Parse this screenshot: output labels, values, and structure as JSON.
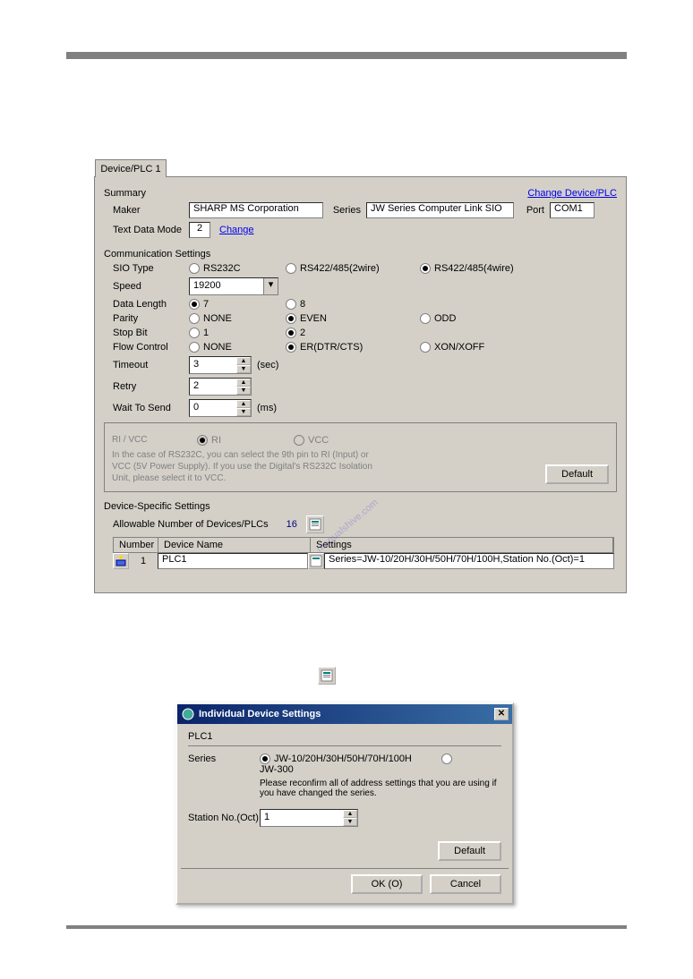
{
  "tab": "Device/PLC 1",
  "summary": {
    "title": "Summary",
    "change_link": "Change Device/PLC",
    "maker_label": "Maker",
    "maker_value": "SHARP MS Corporation",
    "series_label": "Series",
    "series_value": "JW Series Computer Link SIO",
    "port_label": "Port",
    "port_value": "COM1",
    "text_data_mode_label": "Text Data Mode",
    "text_data_mode_value": "2",
    "change_label": "Change"
  },
  "comm": {
    "title": "Communication Settings",
    "sio_type_label": "SIO Type",
    "sio_rs232c": "RS232C",
    "sio_rs422_2w": "RS422/485(2wire)",
    "sio_rs422_4w": "RS422/485(4wire)",
    "speed_label": "Speed",
    "speed_value": "19200",
    "data_length_label": "Data Length",
    "dl_7": "7",
    "dl_8": "8",
    "parity_label": "Parity",
    "parity_none": "NONE",
    "parity_even": "EVEN",
    "parity_odd": "ODD",
    "stop_bit_label": "Stop Bit",
    "sb_1": "1",
    "sb_2": "2",
    "flow_label": "Flow Control",
    "flow_none": "NONE",
    "flow_er": "ER(DTR/CTS)",
    "flow_xon": "XON/XOFF",
    "timeout_label": "Timeout",
    "timeout_value": "3",
    "timeout_unit": "(sec)",
    "retry_label": "Retry",
    "retry_value": "2",
    "wait_label": "Wait To Send",
    "wait_value": "0",
    "wait_unit": "(ms)"
  },
  "rivcc": {
    "title": "RI / VCC",
    "ri": "RI",
    "vcc": "VCC",
    "note": "In the case of RS232C, you can select the 9th pin to RI (Input) or VCC (5V Power Supply). If you use the Digital's RS232C Isolation Unit, please select it to VCC.",
    "default_btn": "Default"
  },
  "device_specific": {
    "title": "Device-Specific Settings",
    "allowable_label": "Allowable Number of Devices/PLCs",
    "allowable_value": "16",
    "col_number": "Number",
    "col_device_name": "Device Name",
    "col_settings": "Settings",
    "row_number": "1",
    "row_name": "PLC1",
    "row_settings": "Series=JW-10/20H/30H/50H/70H/100H,Station No.(Oct)=1"
  },
  "dialog": {
    "title": "Individual Device Settings",
    "plc_name": "PLC1",
    "series_label": "Series",
    "series_jw": "JW-10/20H/30H/50H/70H/100H",
    "series_jw300": "JW-300",
    "series_note": "Please reconfirm all of address settings that you are using if you have changed the series.",
    "station_label": "Station No.(Oct)",
    "station_value": "1",
    "default_btn": "Default",
    "ok_btn": "OK (O)",
    "cancel_btn": "Cancel"
  },
  "watermark": "manualshive.com"
}
